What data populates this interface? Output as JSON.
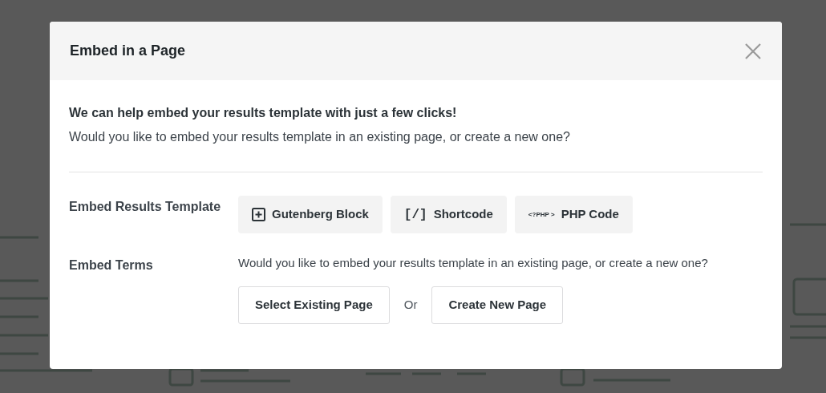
{
  "dialog": {
    "title": "Embed in a Page",
    "intro_heading": "We can help embed your results template with just a few clicks!",
    "intro_text": "Would you like to embed your results template in an existing page, or create a new one?",
    "sections": [
      {
        "kind": "options",
        "label": "Embed Results Template",
        "buttons": [
          {
            "kind": "plus-box",
            "label": "Gutenberg Block"
          },
          {
            "kind": "glyph",
            "glyph": "[/]",
            "label": "Shortcode"
          },
          {
            "kind": "small-glyph",
            "glyph": "<?PHP >",
            "label": "PHP Code"
          }
        ]
      },
      {
        "kind": "choice",
        "label": "Embed Terms",
        "description": "Would you like to embed your results template in an existing page, or create a new one?",
        "actions": [
          "Select Existing Page",
          "Create New Page"
        ],
        "separator": "Or"
      }
    ]
  }
}
